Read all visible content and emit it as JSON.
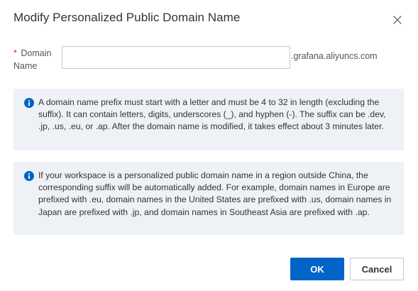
{
  "dialog": {
    "title": "Modify Personalized Public Domain Name"
  },
  "form": {
    "required_marker": "*",
    "label": "Domain Name",
    "input_value": "",
    "input_placeholder": "",
    "suffix": ".grafana.aliyuncs.com"
  },
  "notices": [
    {
      "icon": "info-icon",
      "text": "A domain name prefix must start with a letter and must be 4 to 32 in length (excluding the suffix). It can contain letters, digits, underscores (_), and hyphen (-). The suffix can be .dev, .jp, .us, .eu, or .ap. After the domain name is modified, it takes effect about 3 minutes later."
    },
    {
      "icon": "info-icon",
      "text": "If your workspace is a personalized public domain name in a region outside China, the corresponding suffix will be automatically added. For example, domain names in Europe are prefixed with .eu, domain names in the United States are prefixed with .us, domain names in Japan are prefixed with .jp, and domain names in Southeast Asia are prefixed with .ap."
    }
  ],
  "footer": {
    "ok_label": "OK",
    "cancel_label": "Cancel"
  },
  "colors": {
    "primary": "#0064c8",
    "required": "#d93026",
    "notice_bg": "#eef1f5"
  }
}
